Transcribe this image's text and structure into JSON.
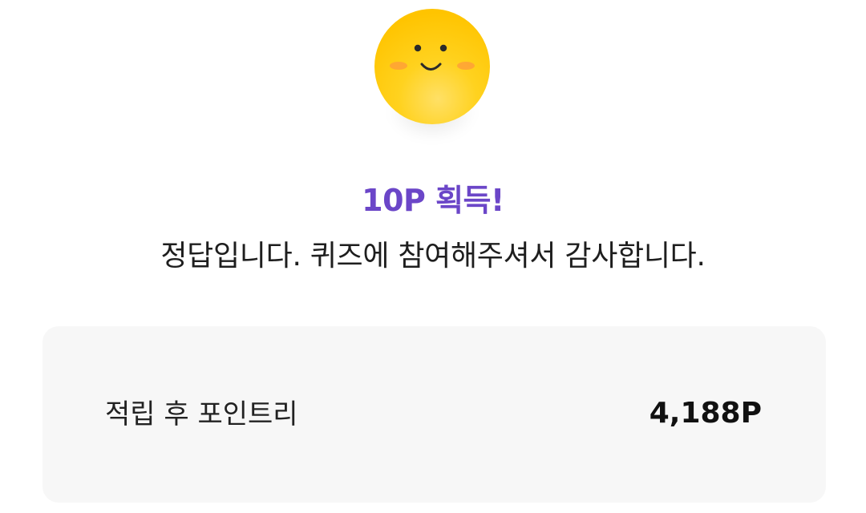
{
  "result": {
    "icon": "smiley-face-icon",
    "reward_text": "10P 획득!",
    "message": "정답입니다. 퀴즈에 참여해주셔서 감사합니다."
  },
  "points_card": {
    "label": "적립 후 포인트리",
    "value": "4,188P"
  },
  "colors": {
    "accent": "#6b46c8",
    "emoji_yellow": "#ffc81e",
    "card_bg": "#f7f7f7",
    "text": "#1e1e1e"
  }
}
